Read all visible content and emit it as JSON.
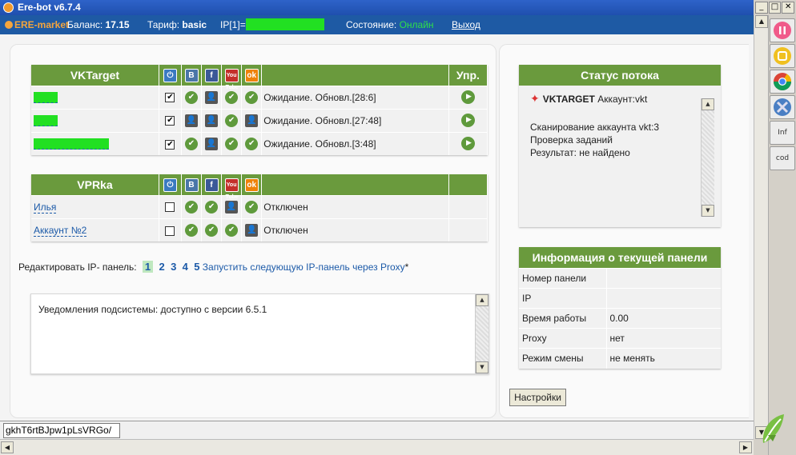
{
  "window": {
    "title": "Ere-bot v6.7.4",
    "buttons": [
      "_",
      "□",
      "✕"
    ]
  },
  "infobar": {
    "brand": "ERE-market",
    "balance_label": "Баланс:",
    "balance_value": "17.15",
    "tariff_label": "Тариф:",
    "tariff_value": "basic",
    "ip_label": "IP[",
    "ip_index": "1",
    "ip_label_end": "]=",
    "status_label": "Состояние:",
    "status_value": "Онлайн",
    "logout": "Выход"
  },
  "colors": {
    "header_green": "#6a9a3d",
    "online": "#2ee04a",
    "info_bar": "#1e5aa4",
    "title_bar": "#2e63c9",
    "mask_green": "#22e022",
    "link": "#1c5aa8"
  },
  "vktarget": {
    "title": "VKTarget",
    "control_header": "Упр.",
    "header_icons": [
      "power-icon",
      "vk-icon",
      "facebook-icon",
      "youtube-icon",
      "odnoklassniki-icon"
    ],
    "header_icon_glyphs": [
      "⏻",
      "B",
      "f",
      "You Tube",
      "ok"
    ],
    "rows": [
      {
        "checked": "✔",
        "icons": [
          "✔",
          "👤",
          "✔",
          "✔"
        ],
        "status": "Ожидание. Обновл.[28:6]",
        "play": "▶"
      },
      {
        "checked": "✔",
        "icons": [
          "👤",
          "👤",
          "✔",
          "👤"
        ],
        "status": "Ожидание. Обновл.[27:48]",
        "play": "▶"
      },
      {
        "checked": "✔",
        "icons": [
          "✔",
          "👤",
          "✔",
          "✔"
        ],
        "status": "Ожидание. Обновл.[3:48]",
        "play": "▶"
      }
    ]
  },
  "vprka": {
    "title": "VPRka",
    "header_icon_glyphs": [
      "⏻",
      "B",
      "f",
      "You Tube",
      "ok"
    ],
    "rows": [
      {
        "name": "Илья",
        "icons": [
          "✔",
          "✔",
          "👤",
          "✔"
        ],
        "status": "Отключен"
      },
      {
        "name": "Аккаунт №2",
        "icons": [
          "✔",
          "✔",
          "✔",
          "👤"
        ],
        "status": "Отключен"
      }
    ]
  },
  "pager": {
    "label": "Редактировать IP- панель:",
    "pages": [
      "1",
      "2",
      "3",
      "4",
      "5"
    ],
    "active_page": "1",
    "proxy_link": "Запустить следующую IP-панель через Proxy",
    "proxy_mark": "*"
  },
  "notifications": {
    "text": "Уведомления подсистемы: доступно с версии 6.5.1"
  },
  "stream": {
    "title": "Статус потока",
    "account_brand": "VKTARGET",
    "account_label": "Аккаунт:vkt",
    "log": [
      "Сканирование аккаунта vkt:3",
      "Проверка заданий",
      "Результат: не найдено"
    ]
  },
  "panel_info": {
    "title": "Информация о текущей панели",
    "rows": [
      {
        "key": "Номер панели",
        "value": ""
      },
      {
        "key": "IP",
        "value": ""
      },
      {
        "key": "Время работы",
        "value": "0.00"
      },
      {
        "key": "Proxy",
        "value": "нет"
      },
      {
        "key": "Режим смены",
        "value": "не менять"
      }
    ]
  },
  "settings_button": "Настройки",
  "command_input": {
    "value": "gkhT6rtBJpw1pLsVRGo/"
  },
  "side_tools": [
    {
      "name": "pause-icon",
      "label": ""
    },
    {
      "name": "stop-icon",
      "label": ""
    },
    {
      "name": "chrome-icon",
      "label": ""
    },
    {
      "name": "tools-icon",
      "label": ""
    },
    {
      "name": "inf-button",
      "label": "Inf"
    },
    {
      "name": "cod-button",
      "label": "cod"
    }
  ]
}
